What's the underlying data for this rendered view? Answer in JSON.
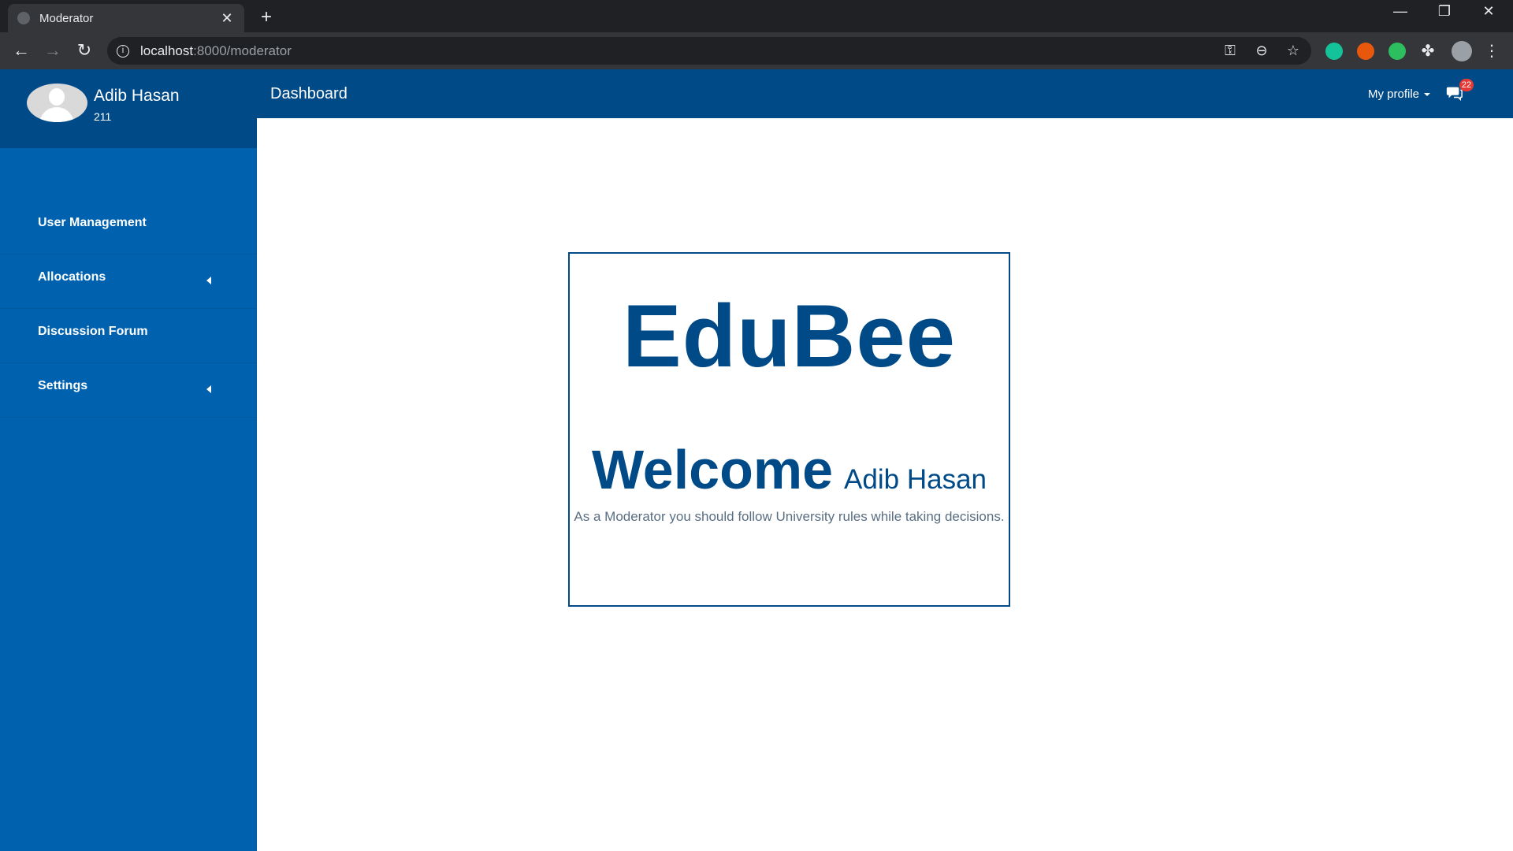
{
  "browser": {
    "tab_title": "Moderator",
    "tab_close": "✕",
    "new_tab": "+",
    "url_host": "localhost",
    "url_path": ":8000/moderator",
    "info_icon": "i",
    "back": "←",
    "forward": "→",
    "reload": "↻",
    "key_icon": "⚿",
    "zoom_icon": "⊖",
    "star_icon": "☆",
    "puzzle_icon": "✤",
    "menu_icon": "⋮",
    "minimize": "—",
    "restore": "❐",
    "close": "✕"
  },
  "sidebar": {
    "user_name": "Adib Hasan",
    "user_id": "211",
    "items": [
      {
        "label": "User Management",
        "has_caret": false
      },
      {
        "label": "Allocations",
        "has_caret": true
      },
      {
        "label": "Discussion Forum",
        "has_caret": false
      },
      {
        "label": "Settings",
        "has_caret": true
      }
    ]
  },
  "header": {
    "title": "Dashboard",
    "profile_label": "My profile",
    "notification_count": "22"
  },
  "card": {
    "brand": "EduBee",
    "welcome": "Welcome",
    "name": "Adib Hasan",
    "note": "As a Moderator you should follow University rules while taking decisions."
  },
  "colors": {
    "primary_dark": "#004a87",
    "sidebar": "#0061ae",
    "badge": "#e53935"
  }
}
